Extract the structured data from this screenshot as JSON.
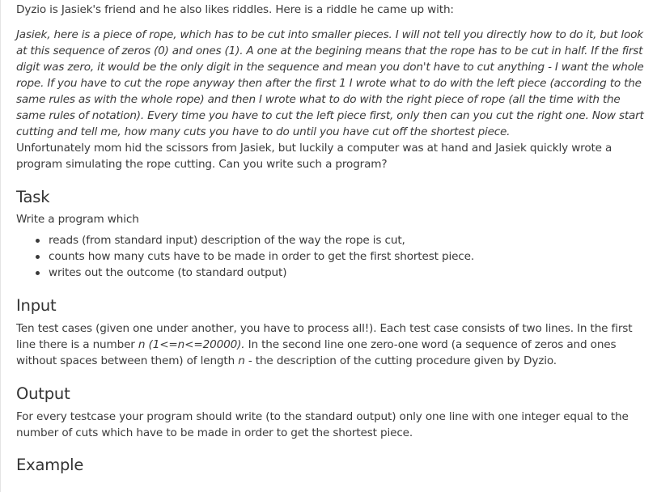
{
  "intro": "Dyzio is Jasiek's friend and he also likes riddles. Here is a riddle he came up with:",
  "riddle": "Jasiek, here is a piece of rope, which has to be cut into smaller pieces. I will not tell you directly how to do it, but look at this sequence of zeros (0) and ones (1). A one at the begining means that the rope has to be cut in half. If the first digit was zero, it would be the only digit in the sequence and mean you don't have to cut anything - I want the whole rope. If you have to cut the rope anyway then after the first 1 I wrote what to do with the left piece (according to the same rules as with the whole rope) and then I wrote what to do with the right piece of rope (all the time with the same rules of notation). Every time you have to cut the left piece first, only then can you cut the right one. Now start cutting and tell me, how many cuts you have to do until you have cut off the shortest piece.",
  "story": "Unfortunately mom hid the scissors from Jasiek, but luckily a computer was at hand and Jasiek quickly wrote a program simulating the rope cutting. Can you write such a program?",
  "task": {
    "heading": "Task",
    "lead": "Write a program which",
    "items": [
      "reads (from standard input) description of the way the rope is cut,",
      "counts how many cuts have to be made in order to get the first shortest piece.",
      "writes out the outcome (to standard output)"
    ]
  },
  "input": {
    "heading": "Input",
    "text_before_n": "Ten test cases (given one under another, you have to process all!). Each test case consists of two lines. In the first line there is a number",
    "constraint": "n (1<=n<=20000).",
    "text_mid": "In the second line one zero-one word (a sequence of zeros and ones without spaces between them) of length",
    "var_n": "n",
    "text_after": "- the description of the cutting procedure given by Dyzio."
  },
  "output": {
    "heading": "Output",
    "text": "For every testcase your program should write (to the standard output) only one line with one integer equal to the number of cuts which have to be made in order to get the shortest piece."
  },
  "example": {
    "heading": "Example"
  }
}
